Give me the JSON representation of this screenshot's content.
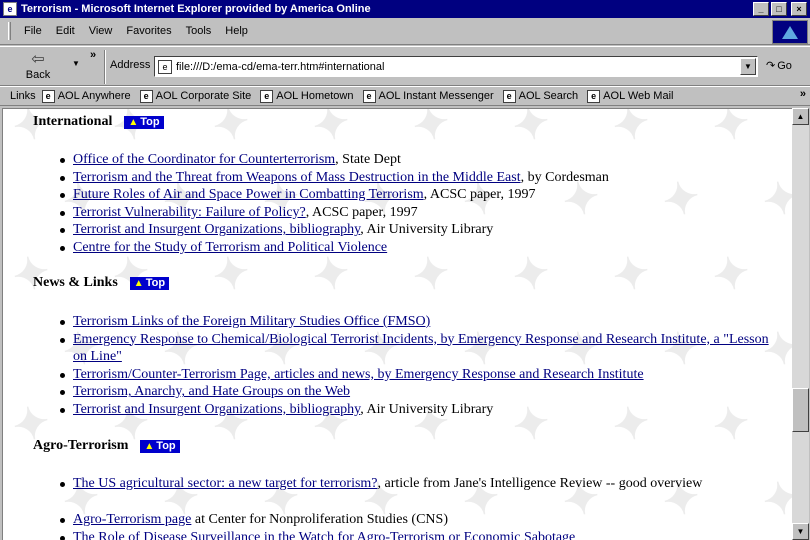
{
  "window": {
    "title": "Terrorism - Microsoft Internet Explorer provided by America Online",
    "buttons": {
      "minimize": "_",
      "maximize": "□",
      "close": "×"
    }
  },
  "menubar": {
    "items": [
      "File",
      "Edit",
      "View",
      "Favorites",
      "Tools",
      "Help"
    ]
  },
  "toolbar": {
    "back_label": "Back",
    "address_label": "Address",
    "url": "file:///D:/ema-cd/ema-terr.htm#international",
    "go_label": "Go"
  },
  "linksbar": {
    "label": "Links",
    "items": [
      "AOL Anywhere",
      "AOL Corporate Site",
      "AOL Hometown",
      "AOL Instant Messenger",
      "AOL Search",
      "AOL Web Mail"
    ]
  },
  "top_badge_label": "Top",
  "sections": [
    {
      "heading": "International",
      "items": [
        {
          "link": "Office of the Coordinator for Counterterrorism",
          "suffix": ", State Dept"
        },
        {
          "link": "Terrorism and the Threat from Weapons of Mass Destruction in the Middle East",
          "suffix": ", by Cordesman"
        },
        {
          "link": "Future Roles of Air and Space Power in Combatting Terrorism",
          "suffix": ", ACSC paper, 1997"
        },
        {
          "link": "Terrorist Vulnerability: Failure of Policy?",
          "suffix": ", ACSC paper, 1997"
        },
        {
          "link": "Terrorist and Insurgent Organizations, bibliography",
          "suffix": ", Air University Library"
        },
        {
          "link": "Centre for the Study of Terrorism and Political Violence",
          "suffix": ""
        }
      ]
    },
    {
      "heading": "News & Links",
      "items": [
        {
          "link": "Terrorism Links of the Foreign Military Studies Office (FMSO)",
          "suffix": ""
        },
        {
          "link": "Emergency Response to Chemical/Biological Terrorist Incidents, by Emergency Response and Research Institute, a \"Lesson on Line\"",
          "suffix": ""
        },
        {
          "link": "Terrorism/Counter-Terrorism Page, articles and news, by Emergency Response and Research Institute",
          "suffix": ""
        },
        {
          "link": "Terrorism, Anarchy, and Hate Groups on the Web",
          "suffix": ""
        },
        {
          "link": "Terrorist and Insurgent Organizations, bibliography",
          "suffix": ", Air University Library"
        }
      ]
    },
    {
      "heading": "Agro-Terrorism",
      "items": [
        {
          "link": "The US agricultural sector: a new target for terrorism?",
          "suffix": ", article from Jane's Intelligence Review -- good overview"
        },
        {
          "link": "Agro-Terrorism page",
          "suffix": " at Center for Nonproliferation Studies (CNS)"
        },
        {
          "link": "The Role of Disease Surveillance in the Watch for Agro-Terrorism or Economic Sabotage",
          "suffix": ""
        }
      ]
    }
  ]
}
